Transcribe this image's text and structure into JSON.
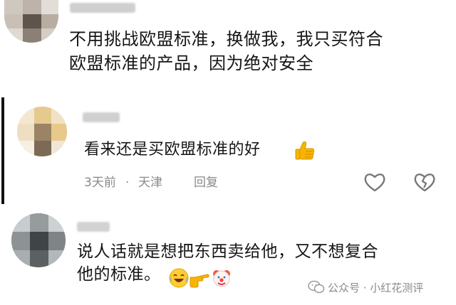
{
  "comments": [
    {
      "text_lines": [
        "不用挑战欧盟标准，换做我，我只买符合",
        "欧盟标准的产品，因为绝对安全"
      ]
    },
    {
      "text": "看来还是买欧盟标准的好",
      "time": "3天前",
      "separator": "·",
      "location": "天津",
      "reply_label": "回复",
      "icons": [
        "thumbs-up-icon",
        "heart-icon",
        "broken-heart-icon"
      ]
    },
    {
      "text_lines": [
        "说人话就是想把东西卖给他，又不想复合",
        "他的标准。"
      ],
      "icons": [
        "laughing-face-icon",
        "pointing-hand-icon",
        "clown-face-icon"
      ]
    }
  ],
  "watermark": {
    "text": "公众号 · 小红花测评",
    "icon": "wechat-icon"
  },
  "colors": {
    "text": "#151515",
    "meta": "#8a8a8a",
    "thumb": "#f7b500"
  }
}
